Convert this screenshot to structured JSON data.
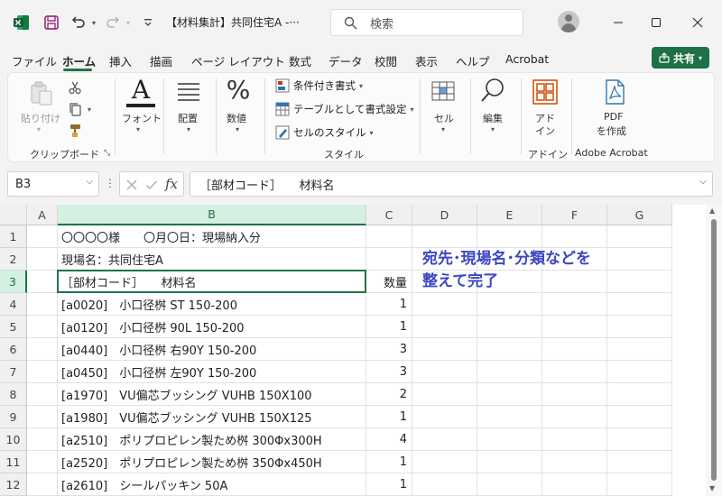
{
  "window": {
    "title": "【材料集計】共同住宅A -···",
    "search_placeholder": "検索"
  },
  "menu": {
    "items": [
      "ファイル",
      "ホーム",
      "挿入",
      "描画",
      "ページ レイアウト",
      "数式",
      "データ",
      "校閲",
      "表示",
      "ヘルプ",
      "Acrobat"
    ],
    "active": "ホーム",
    "share_label": "共有"
  },
  "ribbon": {
    "clipboard": {
      "paste": "貼り付け",
      "group": "クリップボード"
    },
    "font": {
      "label": "フォント"
    },
    "alignment": {
      "label": "配置"
    },
    "number": {
      "label": "数値",
      "symbol": "%"
    },
    "styles": {
      "conditional": "条件付き書式",
      "table": "テーブルとして書式設定",
      "cell_styles": "セルのスタイル",
      "group": "スタイル"
    },
    "cells": {
      "label": "セル"
    },
    "editing": {
      "label": "編集"
    },
    "addin": {
      "label_line1": "アド",
      "label_line2": "イン",
      "group": "アドイン"
    },
    "acrobat": {
      "label_line1": "PDF",
      "label_line2": "を作成",
      "group": "Adobe Acrobat"
    }
  },
  "formula_bar": {
    "name_box": "B3",
    "formula": "［部材コード］　　材料名"
  },
  "columns": [
    "A",
    "B",
    "C",
    "D",
    "E",
    "F",
    "G"
  ],
  "selected_column": "B",
  "selected_row": 3,
  "rows": [
    {
      "num": "1",
      "b": "〇〇〇〇様　　〇月〇日：現場納入分",
      "c": ""
    },
    {
      "num": "2",
      "b": "現場名：共同住宅A",
      "c": ""
    },
    {
      "num": "3",
      "b": "［部材コード］　　材料名",
      "c": "数量"
    },
    {
      "num": "4",
      "b": "[a0020]　小口径桝 ST 150-200",
      "c": "1"
    },
    {
      "num": "5",
      "b": "[a0120]　小口径桝 90L 150-200",
      "c": "1"
    },
    {
      "num": "6",
      "b": "[a0440]　小口径桝 右90Y 150-200",
      "c": "3"
    },
    {
      "num": "7",
      "b": "[a0450]　小口径桝 左90Y 150-200",
      "c": "3"
    },
    {
      "num": "8",
      "b": "[a1970]　VU偏芯ブッシング VUHB 150X100",
      "c": "2"
    },
    {
      "num": "9",
      "b": "[a1980]　VU偏芯ブッシング VUHB 150X125",
      "c": "1"
    },
    {
      "num": "10",
      "b": "[a2510]　ポリプロピレン製ため桝 300Φx300H",
      "c": "4"
    },
    {
      "num": "11",
      "b": "[a2520]　ポリプロピレン製ため桝 350Φx450H",
      "c": "1"
    },
    {
      "num": "12",
      "b": "[a2610]　シールパッキン 50A",
      "c": "1"
    }
  ],
  "annotation": {
    "line1": "宛先･現場名･分類などを",
    "line2": "整えて完了"
  },
  "colors": {
    "excel_green": "#217346",
    "annotation_blue": "#3c46c2"
  }
}
